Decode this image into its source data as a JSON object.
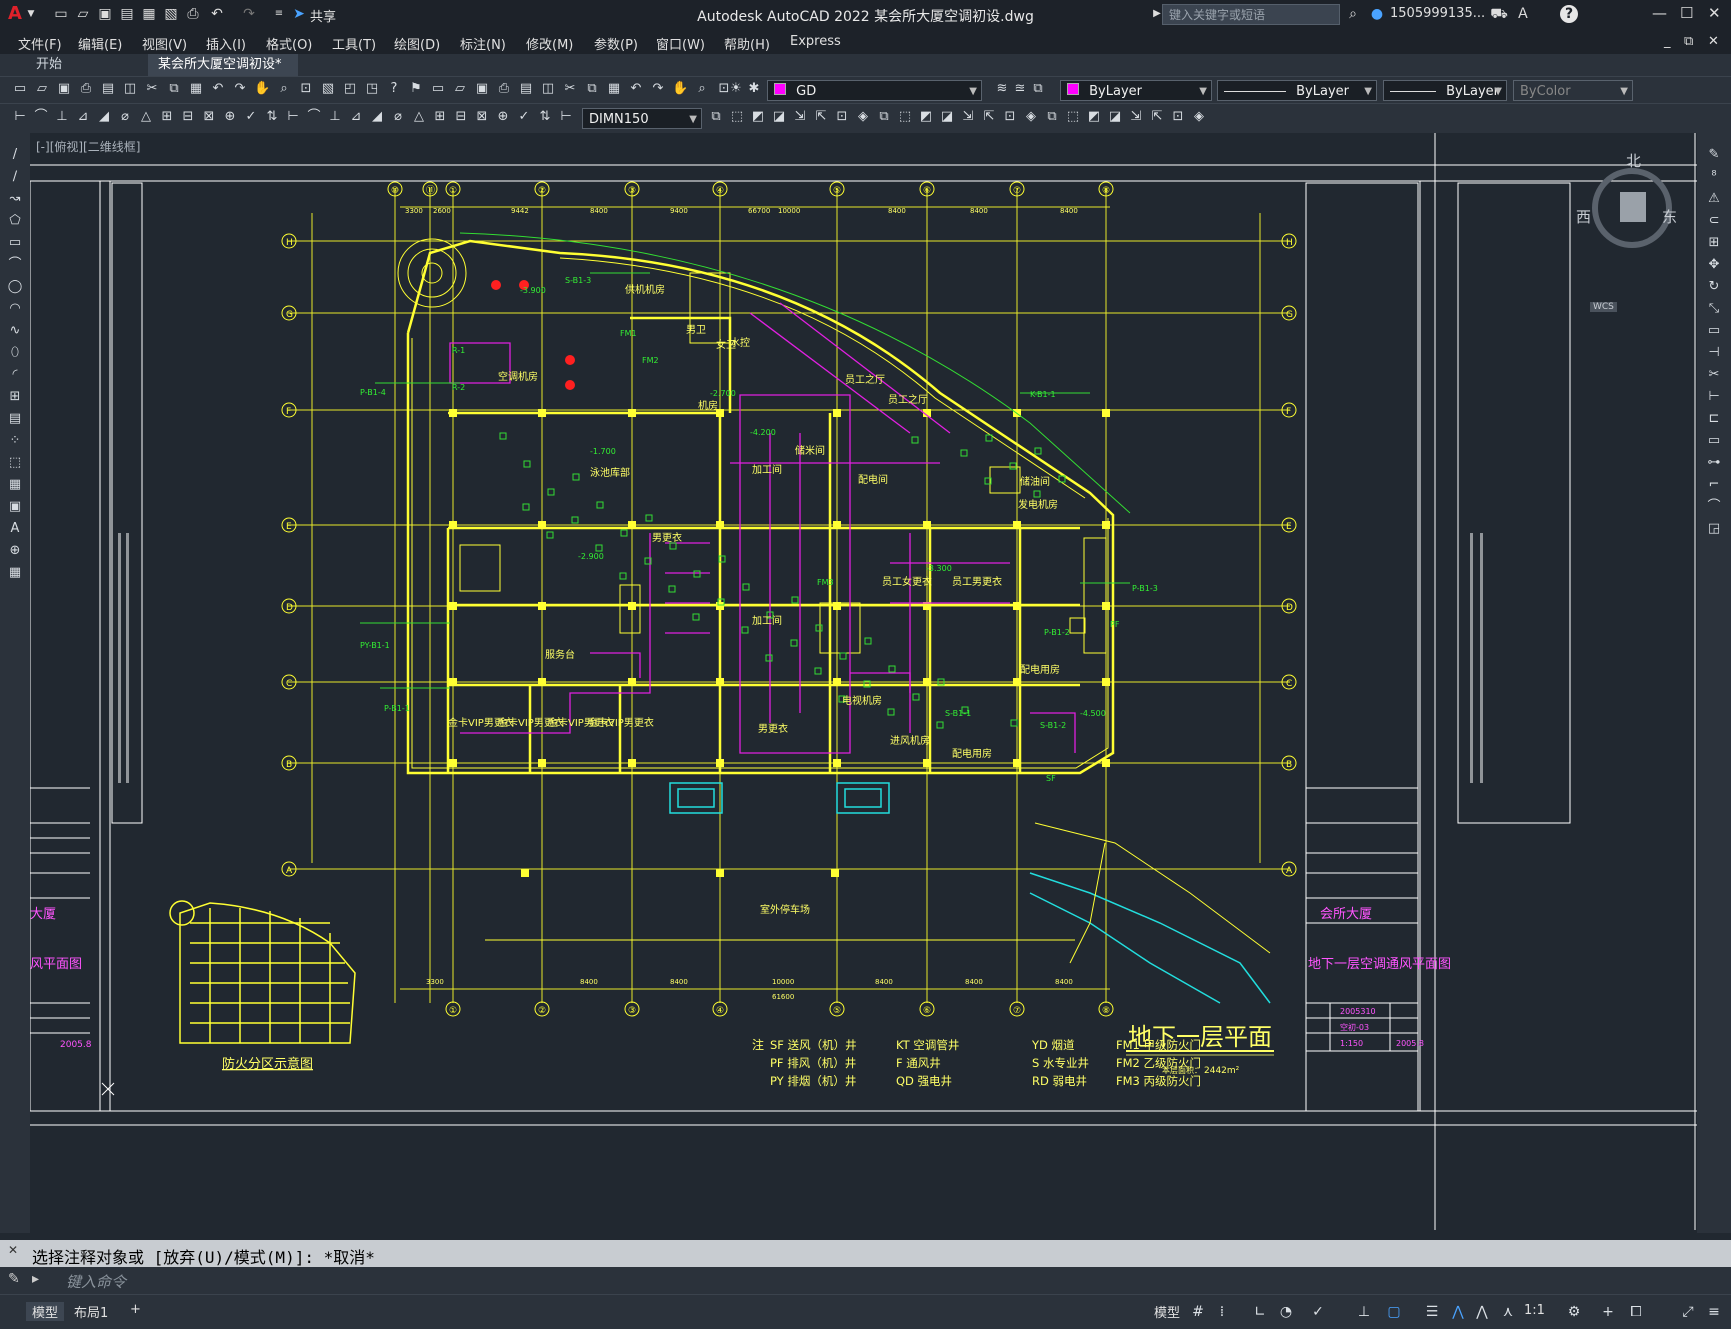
{
  "app": {
    "logo": "A",
    "title": "Autodesk AutoCAD 2022    某会所大厦空调初设.dwg",
    "share_label": "共享",
    "search_placeholder": "键入关键字或短语",
    "user": "1505999135...",
    "help": "?"
  },
  "menu": [
    "文件(F)",
    "编辑(E)",
    "视图(V)",
    "插入(I)",
    "格式(O)",
    "工具(T)",
    "绘图(D)",
    "标注(N)",
    "修改(M)",
    "参数(P)",
    "窗口(W)",
    "帮助(H)",
    "Express"
  ],
  "tabs": {
    "start": "开始",
    "active": "某会所大厦空调初设*",
    "close": "×",
    "add": "+"
  },
  "properties": {
    "layer": "GD",
    "color": "ByLayer",
    "linetype": "ByLayer",
    "lineweight": "ByLayer",
    "plotstyle": "ByColor",
    "dimstyle": "DIMN150",
    "layer_color_hex": "#ff00ff"
  },
  "viewport": {
    "label": "[-][俯视][二维线框]",
    "viewcube": {
      "north": "北",
      "west": "西",
      "east": "东",
      "wcs": "WCS"
    }
  },
  "drawing": {
    "title": "地下一层平面",
    "area_label": "本层面积：",
    "area_value": "2442m²",
    "key_plan_label": "防火分区示意图",
    "outdoor_parking": "室外停车场",
    "titleblock_project": "会所大厦",
    "titleblock_sheet": "地下一层空调通风平面图",
    "titleblock_code": "2005310",
    "titleblock_number": "空初-03",
    "titleblock_scale": "1:150",
    "titleblock_date": "2005.8",
    "left_project_fragment": "大厦",
    "left_sheet_fragment": "风平面图",
    "left_date_fragment": "2005.8",
    "grid_bubbles_top": [
      "⑩",
      "⑪",
      "①",
      "②",
      "③",
      "④",
      "⑤",
      "⑥",
      "⑦",
      "⑧"
    ],
    "grid_bubbles_bottom": [
      "①",
      "②",
      "③",
      "④",
      "⑤",
      "⑥",
      "⑦",
      "⑧"
    ],
    "grid_rows": [
      "H",
      "G",
      "F",
      "E",
      "D",
      "C",
      "B",
      "A"
    ],
    "dims_top": [
      "3300",
      "2600",
      "9442",
      "8400",
      "9400",
      "66700",
      "10000",
      "8400",
      "8400",
      "8400"
    ],
    "dims_bottom": [
      "3300",
      "8400",
      "8400",
      "10000",
      "8400",
      "8400",
      "8400",
      "61600"
    ],
    "room_labels": [
      "空调机房",
      "供机机房",
      "泳池库部",
      "员工之厅",
      "员工之厅",
      "加工间",
      "储米间",
      "配电间",
      "发电机房",
      "储油间",
      "男更衣",
      "员工女更衣",
      "员工男更衣",
      "配电用房",
      "电视机房",
      "进风机房",
      "配电用房",
      "金卡VIP男更衣",
      "金卡VIP男更衣",
      "金卡VIP男更衣",
      "金卡VIP男更衣",
      "男更衣",
      "服务台",
      "水控",
      "男卫",
      "女卫",
      "加工间",
      "机房"
    ],
    "tag_labels": [
      "R-1",
      "R-2",
      "P-B1-4",
      "P-B1-1",
      "PY-B1-1",
      "K-B1-1",
      "P-B1-3",
      "P-B1-2",
      "S-B1-1",
      "S-B1-2",
      "S-B1-3",
      "FM1",
      "FM2",
      "FM3",
      "PF",
      "SF",
      "-3.900",
      "-4.200",
      "-2.900",
      "-4.500",
      "-1.700",
      "-3.300",
      "-2.700"
    ],
    "legend": {
      "note": "注",
      "col1": [
        "SF 送风（机）井",
        "PF 排风（机）井",
        "PY 排烟（机）井"
      ],
      "col2": [
        "KT 空调管井",
        "F   通风井",
        "QD 强电井"
      ],
      "col3": [
        "YD 烟道",
        "S   水专业井",
        "RD 弱电井"
      ],
      "col4": [
        "FM1  甲级防火门",
        "FM2  乙级防火门",
        "FM3  丙级防火门"
      ]
    }
  },
  "command": {
    "history": "选择注释对象或 [放弃(U)/模式(M)]: *取消*",
    "placeholder": "键入命令"
  },
  "status": {
    "tab_model": "模型",
    "tab_layout": "布局1",
    "add": "+",
    "model_label": "模型",
    "scale": "1:1"
  }
}
